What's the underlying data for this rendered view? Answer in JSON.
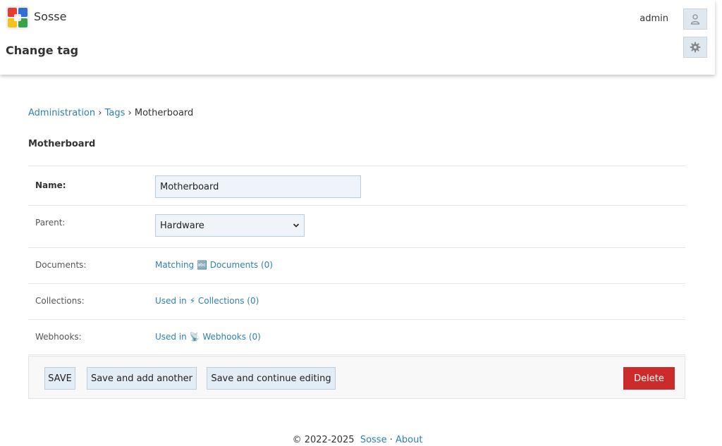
{
  "header": {
    "brand": "Sosse",
    "title": "Change tag",
    "username": "admin"
  },
  "breadcrumb": {
    "items": [
      "Administration",
      "Tags",
      "Motherboard"
    ],
    "separator": "›"
  },
  "object_title": "Motherboard",
  "form": {
    "name": {
      "label": "Name:",
      "value": "Motherboard"
    },
    "parent": {
      "label": "Parent:",
      "selected": "Hardware"
    },
    "documents": {
      "label": "Documents:",
      "link": "Matching 🔤 Documents (0)"
    },
    "collections": {
      "label": "Collections:",
      "link": "Used in ⚡ Collections (0)"
    },
    "webhooks": {
      "label": "Webhooks:",
      "link": "Used in 📡 Webhooks (0)"
    }
  },
  "actions": {
    "save": "SAVE",
    "save_add": "Save and add another",
    "save_continue": "Save and continue editing",
    "delete": "Delete"
  },
  "footer": {
    "copyright": "© 2022-2025",
    "brand_link": "Sosse",
    "separator": "·",
    "about_link": "About"
  },
  "colors": {
    "link": "#2f7fb7",
    "delete": "#cc2b2b",
    "button_bg": "#e3edf5",
    "input_bg": "#eef4fa"
  },
  "icons": {
    "logo": "sosse-logo-icon",
    "user": "user-icon",
    "settings": "gear-icon",
    "select_arrow": "chevron-down-icon"
  }
}
